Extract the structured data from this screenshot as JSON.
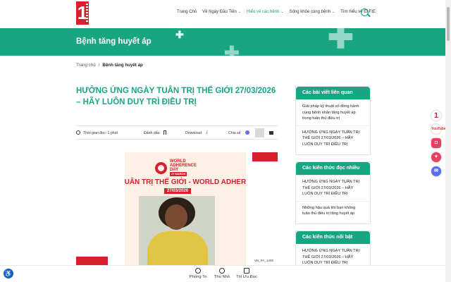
{
  "header": {
    "logo_text": "1",
    "nav": [
      {
        "label": "Trang Chủ",
        "has_dropdown": false
      },
      {
        "label": "Về Ngày Đầu Tiên",
        "has_dropdown": true
      },
      {
        "label": "Hiểu về các bệnh",
        "has_dropdown": true,
        "active": true
      },
      {
        "label": "Sống khỏe cùng bệnh",
        "has_dropdown": true
      },
      {
        "label": "Tìm hiểu về ELFIE",
        "has_dropdown": false
      }
    ]
  },
  "banner": {
    "title": "Bệnh tăng huyết áp"
  },
  "breadcrumb": {
    "home": "Trang chủ",
    "separator": "/",
    "current": "Bệnh tăng huyết áp"
  },
  "article": {
    "title": "HƯỞNG ỨNG NGÀY TUÂN TRỊ THẾ GIỚI 27/03/2026 – HÃY LUÔN DUY TRÌ ĐIỀU TRỊ",
    "meta": {
      "read_time": "Thời gian đọc: 1 phút",
      "bookmark": "Đánh dấu",
      "download": "Download",
      "share": "Chia sẻ"
    },
    "poster": {
      "logo_line1": "WORLD",
      "logo_line2": "ADHERENCE",
      "logo_line3": "DAY",
      "logo_date": "27 MARCH",
      "headline": "NGÀY TUÂN TRỊ THẾ GIỚI - WORLD ADHERENCE DAY",
      "date": "27/03/2026"
    },
    "code": "VN_PA_1408"
  },
  "sidebar": [
    {
      "heading": "Các bài viết liên quan",
      "items": [
        "Giải pháp kỹ thuật số đồng hành cùng bệnh nhân tăng huyết áp trong tuân thủ điều trị",
        "HƯỞNG ỨNG NGÀY TUÂN TRỊ THẾ GIỚI 27/03/2026 – HÃY LUÔN DUY TRÌ ĐIỀU TRỊ"
      ]
    },
    {
      "heading": "Các kiến thức đọc nhiều",
      "items": [
        "HƯỞNG ỨNG NGÀY TUÂN TRỊ THẾ GIỚI 27/03/2026 – HÃY LUÔN DUY TRÌ ĐIỀU TRỊ",
        "Những hậu quả khi bạn không tuân thủ điều trị tăng huyết áp"
      ]
    },
    {
      "heading": "Các kiến thức nổi bật",
      "items": [
        "HƯỞNG ỨNG NGÀY TUÂN TRỊ THẾ GIỚI 27/03/2026 – HÃY LUÔN DUY TRÌ ĐIỀU TRỊ"
      ]
    }
  ],
  "float_icons": [
    {
      "name": "ngaydautien-icon",
      "glyph": "1"
    },
    {
      "name": "youtube-icon",
      "glyph": "YouTube"
    },
    {
      "name": "instagram-icon",
      "glyph": "◘"
    },
    {
      "name": "app-icon",
      "glyph": "♥"
    },
    {
      "name": "messenger-icon",
      "glyph": "✉"
    }
  ],
  "toolbar": {
    "zoom_in": "Phóng To",
    "zoom_out": "Thu Nhỏ",
    "optimize": "Tối Ưu Đọc"
  },
  "colors": {
    "brand_green": "#18a582",
    "brand_red": "#d6202e"
  }
}
